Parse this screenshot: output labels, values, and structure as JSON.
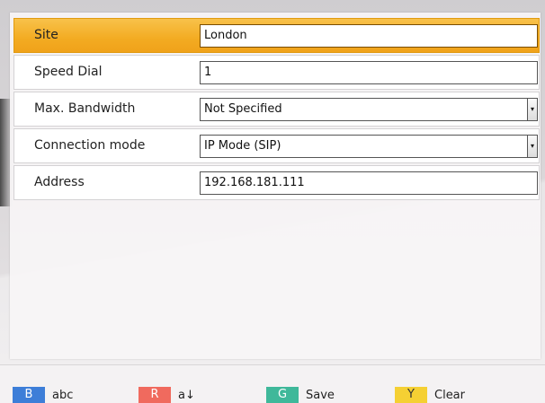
{
  "form": {
    "rows": [
      {
        "label": "Site",
        "value": "London"
      },
      {
        "label": "Speed Dial",
        "value": "1"
      },
      {
        "label": "Max. Bandwidth",
        "value": "Not Specified"
      },
      {
        "label": "Connection mode",
        "value": "IP Mode (SIP)"
      },
      {
        "label": "Address",
        "value": "192.168.181.111"
      }
    ],
    "dropdown_arrow_glyph": "▾"
  },
  "footer": {
    "keys": [
      {
        "badge": "B",
        "label": "abc",
        "color": "#3d7ed8"
      },
      {
        "badge": "R",
        "label": "a↓",
        "color": "#f06a5e"
      },
      {
        "badge": "G",
        "label": "Save",
        "color": "#3fb89a"
      },
      {
        "badge": "Y",
        "label": "Clear",
        "color": "#f5d033"
      }
    ]
  },
  "colors": {
    "selected_row": "#f3ab22",
    "panel_background": "#f7f5f6"
  }
}
